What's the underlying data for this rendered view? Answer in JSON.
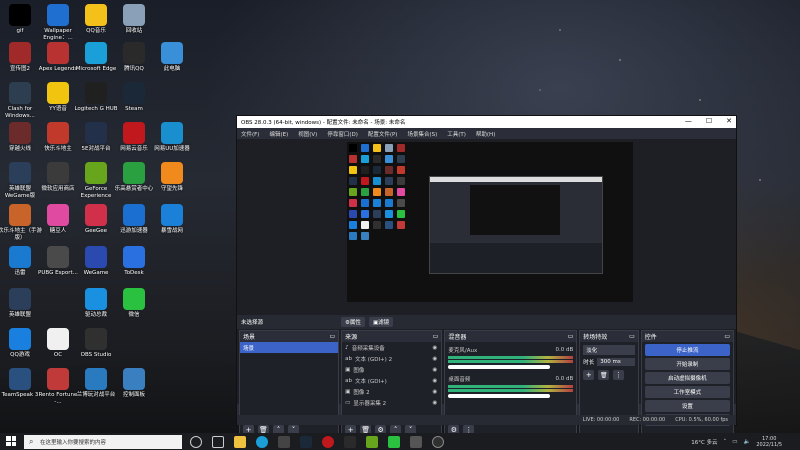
{
  "desktop_icons": [
    {
      "label": "gif",
      "color": "#000000",
      "x": 0,
      "y": 0
    },
    {
      "label": "Wallpaper Engine：...",
      "color": "#1f6fd0"
    },
    {
      "label": "QQ音乐",
      "color": "#f4c11b"
    },
    {
      "label": "回收站",
      "color": "#8aa0b8"
    },
    {
      "label": "宣传图2",
      "color": "#a02a2a"
    },
    {
      "label": "Apex Legends",
      "color": "#b83232"
    },
    {
      "label": "Microsoft Edge",
      "color": "#1a9fd8"
    },
    {
      "label": "腾讯QQ",
      "color": "#2a2a2a"
    },
    {
      "label": "此电脑",
      "color": "#3a90d8"
    },
    {
      "label": "Clash for Windows...",
      "color": "#2c3e50"
    },
    {
      "label": "YY语音",
      "color": "#f1c40f"
    },
    {
      "label": "Logitech G HUB",
      "color": "#202020"
    },
    {
      "label": "Steam",
      "color": "#1b2838"
    },
    {
      "label": "穿越火线",
      "color": "#6b2b2b"
    },
    {
      "label": "快乐斗地主",
      "color": "#c0392b"
    },
    {
      "label": "5E对战平台",
      "color": "#22304a"
    },
    {
      "label": "网易云音乐",
      "color": "#c0181c"
    },
    {
      "label": "网易UU加速器",
      "color": "#1a8fd0"
    },
    {
      "label": "英雄联盟 WeGame版",
      "color": "#2b3e5a"
    },
    {
      "label": "微软应用商店",
      "color": "#3b3b3b"
    },
    {
      "label": "GeForce Experience",
      "color": "#66a51c"
    },
    {
      "label": "乐高悬赏者中心",
      "color": "#2aa040"
    },
    {
      "label": "守望先锋",
      "color": "#f08a1c"
    },
    {
      "label": "欢乐斗地主（手游版）",
      "color": "#c8642a"
    },
    {
      "label": "糖豆人",
      "color": "#e04aa0"
    },
    {
      "label": "GeeGee",
      "color": "#d0304a"
    },
    {
      "label": "迅游加速器",
      "color": "#1a6fd0"
    },
    {
      "label": "暴雪战网",
      "color": "#1a80d8"
    },
    {
      "label": "迅雷",
      "color": "#1a7ad0"
    },
    {
      "label": "PUBG Esport...",
      "color": "#4a4a4a"
    },
    {
      "label": "WeGame",
      "color": "#2a4ab0"
    },
    {
      "label": "ToDesk",
      "color": "#2a70e0"
    },
    {
      "label": "英雄联盟",
      "color": "#2b3e5a"
    },
    {
      "label": "驱动总裁",
      "color": "#1a90e0"
    },
    {
      "label": "微信",
      "color": "#2ac040"
    },
    {
      "label": "QQ游戏",
      "color": "#1a80e0"
    },
    {
      "label": "OC",
      "color": "#f0f0f0"
    },
    {
      "label": "OBS Studio",
      "color": "#303030"
    },
    {
      "label": "TeamSpeak 3",
      "color": "#2a5080"
    },
    {
      "label": "Rento Fortune -...",
      "color": "#c03a3a"
    },
    {
      "label": "兰博玩对战平台",
      "color": "#2a7ac0"
    },
    {
      "label": "控制面板",
      "color": "#3a80c0"
    }
  ],
  "obs": {
    "title": "OBS 28.0.3 (64-bit, windows) - 配置文件: 未命名 - 场景: 未命名",
    "menu": [
      "文件(F)",
      "编辑(E)",
      "视图(V)",
      "停靠窗口(D)",
      "配置文件(P)",
      "场景集合(S)",
      "工具(T)",
      "帮助(H)"
    ],
    "scene_bar": {
      "label": "未选择源",
      "props": "⚙属性",
      "filters": "▣滤镜"
    },
    "docks": {
      "scenes": {
        "title": "场景",
        "items": [
          "场景"
        ]
      },
      "sources": {
        "title": "来源",
        "items": [
          "音频采集设备",
          "文本 (GDI+) 2",
          "图像",
          "文本 (GDI+)",
          "图像 2",
          "显示器采集 2"
        ]
      },
      "mixer": {
        "title": "混音器",
        "channels": [
          {
            "name": "麦克风/Aux",
            "db": "0.0 dB"
          },
          {
            "name": "桌面音频",
            "db": "0.0 dB"
          }
        ]
      },
      "transitions": {
        "title": "转场特效",
        "type": "淡化",
        "duration_label": "时长",
        "duration": "300 ms"
      },
      "controls": {
        "title": "控件",
        "buttons": [
          "停止推流",
          "开始录制",
          "启动虚拟摄像机",
          "工作室模式",
          "设置",
          "退出"
        ]
      }
    },
    "status": {
      "live": "LIVE: 00:00:00",
      "rec": "REC: 00:00:00",
      "cpu": "CPU: 0.5%, 60.00 fps"
    }
  },
  "taskbar": {
    "search_placeholder": "在这里输入你要搜索的内容",
    "weather": "16°C 多云",
    "time": "17:00",
    "date": "2022/11/5"
  }
}
